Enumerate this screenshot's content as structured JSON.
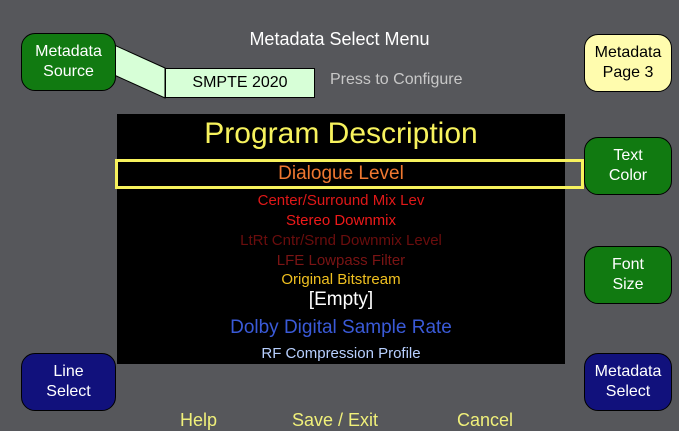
{
  "header": {
    "title": "Metadata Select Menu"
  },
  "metadata_source": {
    "button_label_line1": "Metadata",
    "button_label_line2": "Source",
    "current_value": "SMPTE 2020",
    "hint": "Press to Configure"
  },
  "right_buttons": {
    "page": {
      "line1": "Metadata",
      "line2": "Page 3"
    },
    "text_color": {
      "line1": "Text",
      "line2": "Color"
    },
    "font_size": {
      "line1": "Font",
      "line2": "Size"
    },
    "metadata_select": {
      "line1": "Metadata",
      "line2": "Select"
    }
  },
  "left_buttons": {
    "line_select": {
      "line1": "Line",
      "line2": "Select"
    }
  },
  "list": {
    "title": "Program Description",
    "items": [
      {
        "label": "Dialogue Level",
        "color": "#f07830",
        "selected": true
      },
      {
        "label": "Center/Surround Mix Lev",
        "color": "#e01818"
      },
      {
        "label": "Stereo Downmix",
        "color": "#ee1a1a"
      },
      {
        "label": "LtRt Cntr/Srnd Downmix Level",
        "color": "#6a0d0d"
      },
      {
        "label": "LFE Lowpass Filter",
        "color": "#7a1414"
      },
      {
        "label": "Original Bitstream",
        "color": "#f0c020"
      },
      {
        "label": "[Empty]",
        "color": "#ffffff"
      },
      {
        "label": "Dolby Digital Sample Rate",
        "color": "#3a5ad8"
      },
      {
        "label": "RF Compression Profile",
        "color": "#b8d0ff"
      }
    ]
  },
  "footer": {
    "help": "Help",
    "save_exit": "Save / Exit",
    "cancel": "Cancel"
  },
  "colors": {
    "background": "#56575b",
    "title_yellow": "#f7f25d",
    "selection_border": "#f7f25d"
  }
}
